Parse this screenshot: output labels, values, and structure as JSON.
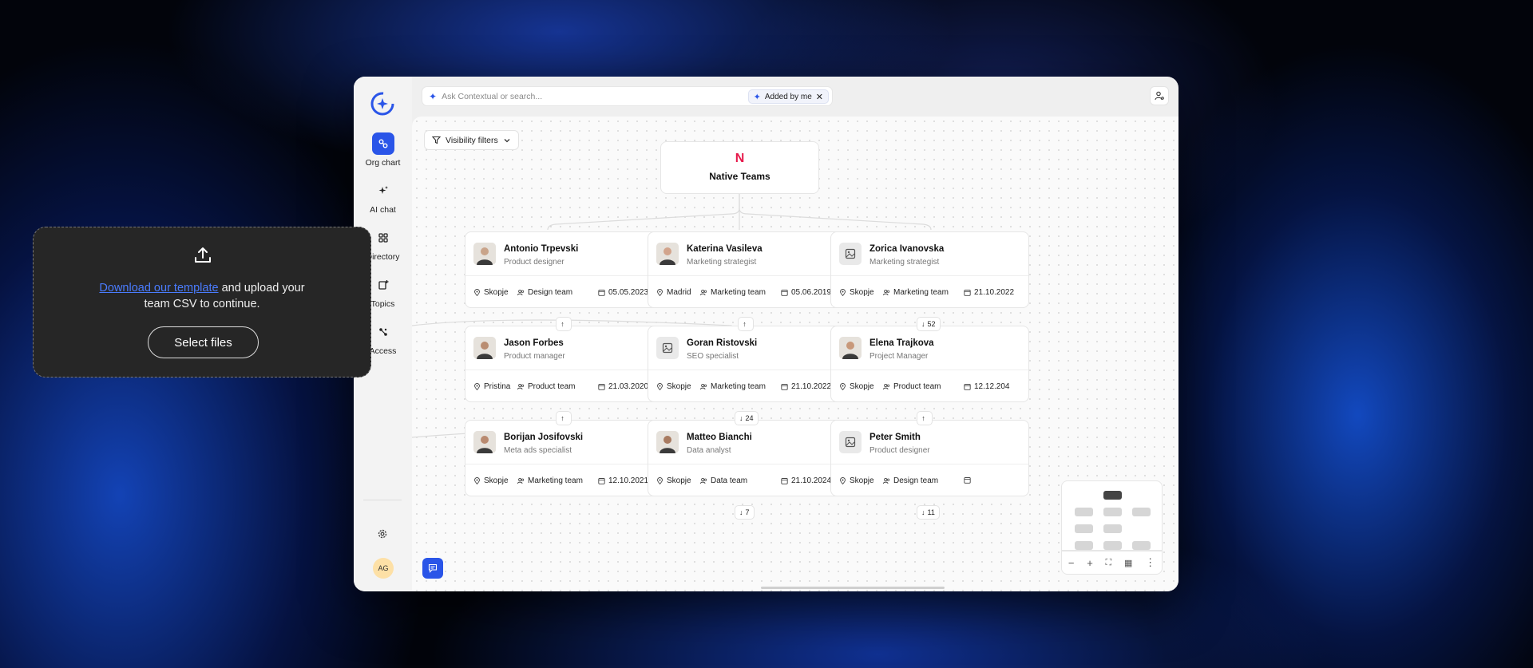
{
  "sidebar": {
    "items": [
      {
        "label": "Org chart",
        "icon": "org-chart-icon",
        "active": true
      },
      {
        "label": "AI chat",
        "icon": "ai-sparkle-icon",
        "active": false
      },
      {
        "label": "Directory",
        "icon": "grid-icon",
        "active": false
      },
      {
        "label": "Topics",
        "icon": "topics-icon",
        "active": false
      },
      {
        "label": "Access",
        "icon": "access-icon",
        "active": false
      }
    ],
    "user_initials": "AG"
  },
  "search": {
    "placeholder": "Ask Contextual or search...",
    "filter_chip": "Added by me"
  },
  "canvas": {
    "visibility_filter_label": "Visibility filters",
    "root": {
      "brand_mark": "N",
      "name": "Native Teams"
    },
    "cards": [
      {
        "name": "Antonio Trpevski",
        "role": "Product designer",
        "location": "Skopje",
        "team": "Design team",
        "date": "05.05.2023",
        "avatar": "photo"
      },
      {
        "name": "Katerina Vasileva",
        "role": "Marketing strategist",
        "location": "Madrid",
        "team": "Marketing team",
        "date": "05.06.2019",
        "avatar": "photo"
      },
      {
        "name": "Zorica Ivanovska",
        "role": "Marketing strategist",
        "location": "Skopje",
        "team": "Marketing team",
        "date": "21.10.2022",
        "avatar": "placeholder"
      },
      {
        "name": "Jason Forbes",
        "role": "Product manager",
        "location": "Pristina",
        "team": "Product team",
        "date": "21.03.2020",
        "avatar": "photo"
      },
      {
        "name": "Goran Ristovski",
        "role": "SEO specialist",
        "location": "Skopje",
        "team": "Marketing team",
        "date": "21.10.2022",
        "avatar": "placeholder"
      },
      {
        "name": "Elena Trajkova",
        "role": "Project Manager",
        "location": "Skopje",
        "team": "Product team",
        "date": "12.12.204",
        "avatar": "photo"
      },
      {
        "name": "Borijan Josifovski",
        "role": "Meta ads specialist",
        "location": "Skopje",
        "team": "Marketing team",
        "date": "12.10.2021",
        "avatar": "photo"
      },
      {
        "name": "Matteo Bianchi",
        "role": "Data analyst",
        "location": "Skopje",
        "team": "Data team",
        "date": "21.10.2024",
        "avatar": "photo"
      },
      {
        "name": "Peter Smith",
        "role": "Product designer",
        "location": "Skopje",
        "team": "Design team",
        "date": "",
        "avatar": "placeholder"
      }
    ],
    "expanders": [
      {
        "arrow": "↑",
        "count": ""
      },
      {
        "arrow": "↑",
        "count": ""
      },
      {
        "arrow": "↓",
        "count": "52"
      },
      {
        "arrow": "↑",
        "count": ""
      },
      {
        "arrow": "↓",
        "count": "24"
      },
      {
        "arrow": "↑",
        "count": ""
      },
      {
        "arrow": "↓",
        "count": "7"
      },
      {
        "arrow": "↓",
        "count": "11"
      }
    ]
  },
  "zoom_controls": {
    "zoom_out": "−",
    "zoom_in": "+",
    "fit": "⛶",
    "map": "▦",
    "more": "⋮"
  },
  "upload": {
    "link_text": "Download our template",
    "text_after_link": " and upload your",
    "line2": "team CSV to continue.",
    "button_label": "Select files"
  },
  "colors": {
    "accent": "#2a55e8",
    "brand": "#e6194b",
    "upload_bg": "#262626"
  }
}
